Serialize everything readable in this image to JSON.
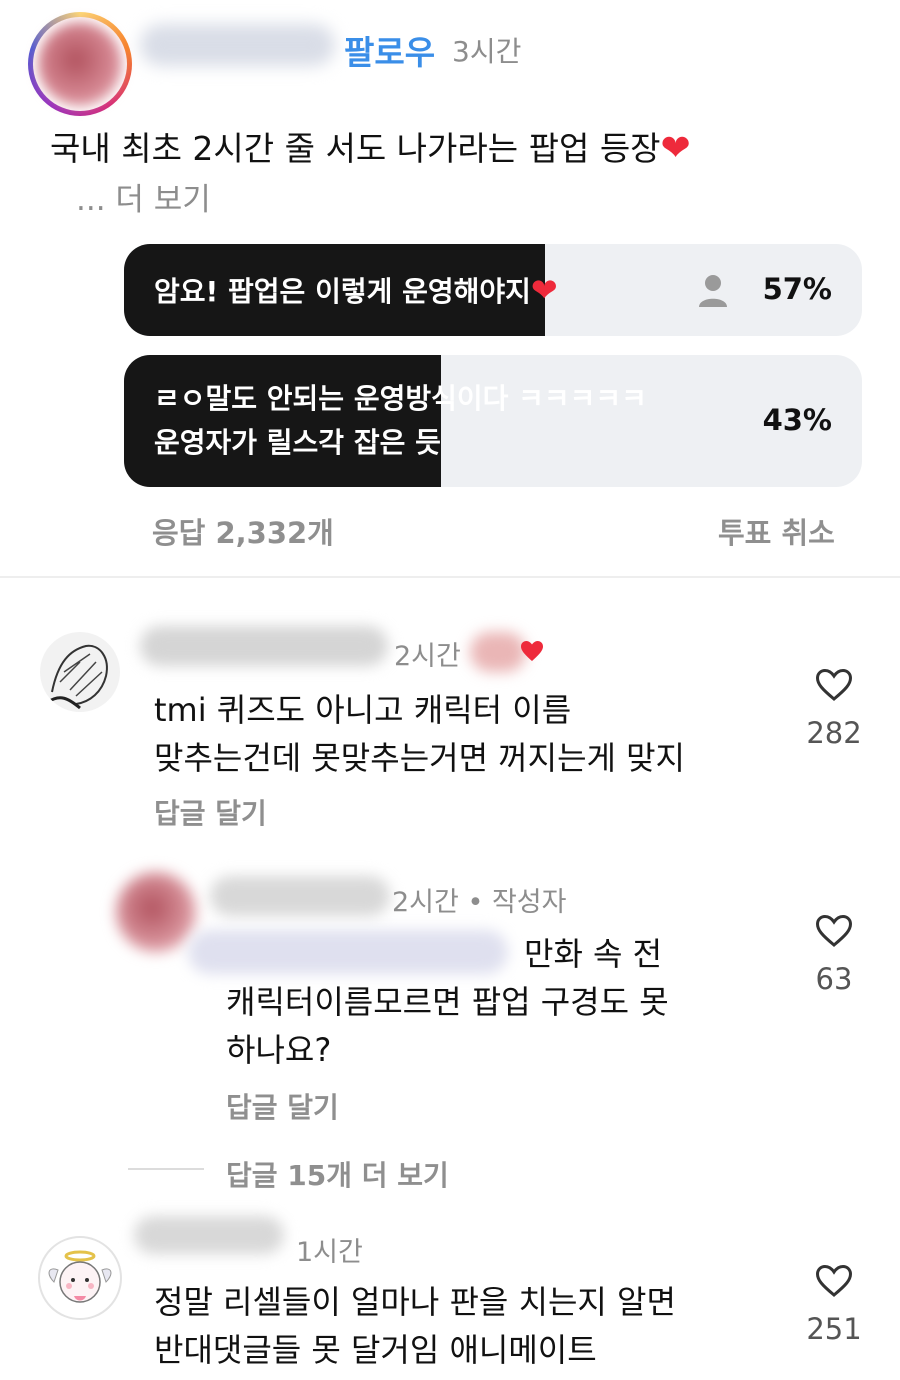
{
  "post": {
    "follow_label": "팔로우",
    "time": "3시간",
    "caption": "국내 최초 2시간 줄 서도 나가라는 팝업 등장",
    "caption_emoji": "❤",
    "more": "... 더 보기"
  },
  "poll": {
    "options": [
      {
        "label_line1": "암요! 팝업은 이렇게 운영해야지",
        "label_emoji": "❤",
        "percent_label": "57%",
        "percent": 57
      },
      {
        "label_line1": "ㄹㅇ말도 안되는 운영방식이다 ㅋㅋㅋㅋㅋ",
        "label_line2": "운영자가 릴스각 잡은 듯",
        "percent_label": "43%",
        "percent": 43
      }
    ],
    "responses": "응답 2,332개",
    "cancel_vote": "투표 취소"
  },
  "comments": [
    {
      "time": "2시간",
      "text_line1": "tmi 퀴즈도 아니고 캐릭터 이름",
      "text_line2": "맞추는건데 못맞추는거면 꺼지는게 맞지",
      "reply": "답글 달기",
      "likes": "282"
    },
    {
      "time": "2시간 • 작성자",
      "text_line1_suffix": "만화 속 전",
      "text_line2": "캐릭터이름모르면 팝업 구경도 못",
      "text_line3": "하나요?",
      "reply": "답글 달기",
      "likes": "63"
    },
    {
      "view_more_replies": "답글 15개 더 보기"
    },
    {
      "time": "1시간",
      "text_line1": "정말 리셀들이 얼마나 판을 치는지 알면",
      "text_line2": "반대댓글들 못 달거임 애니메이트",
      "likes": "251"
    }
  ],
  "colors": {
    "follow": "#3a8ee8",
    "poll_fill": "#161616",
    "poll_bg": "#eef0f3",
    "heart": "#ee2a3b"
  },
  "icons": {
    "like": "heart-outline-icon",
    "voter": "person-icon"
  }
}
